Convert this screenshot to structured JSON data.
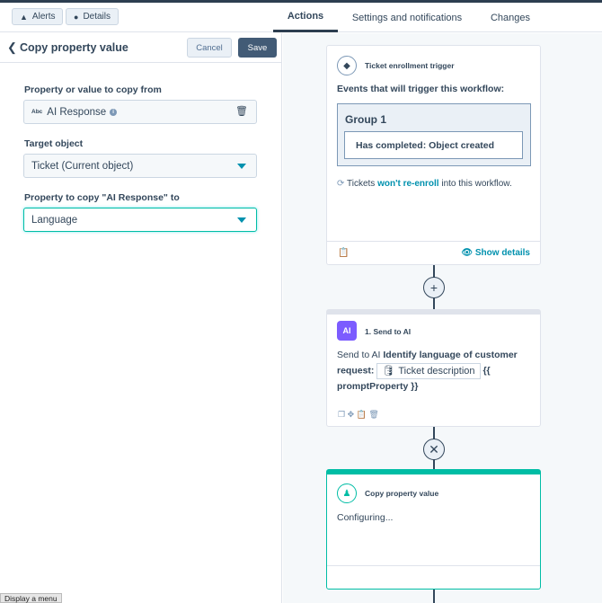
{
  "topbar": {
    "alerts_label": "Alerts",
    "details_label": "Details",
    "tabs": [
      {
        "label": "Actions"
      },
      {
        "label": "Settings and notifications"
      },
      {
        "label": "Changes"
      }
    ]
  },
  "panel": {
    "title": "Copy property value",
    "cancel_label": "Cancel",
    "save_label": "Save",
    "fields": {
      "source_label": "Property or value to copy from",
      "source_badge": "Abc",
      "source_value": "AI Response",
      "target_label": "Target object",
      "target_value": "Ticket (Current object)",
      "dest_label": "Property to copy \"AI Response\" to",
      "dest_value": "Language"
    },
    "menu_hint": "Display a menu"
  },
  "workflow": {
    "trigger": {
      "title": "Ticket enrollment trigger",
      "subtitle": "Events that will trigger this workflow:",
      "group_title": "Group 1",
      "condition": "Has completed: Object created",
      "reenroll_prefix": "Tickets",
      "reenroll_link": "won't re-enroll",
      "reenroll_suffix": "into this workflow.",
      "show_details": "Show details"
    },
    "step1": {
      "icon_text": "AI",
      "title": "1. Send to AI",
      "text_prefix": "Send to AI",
      "text_bold": "Identify language of customer request:",
      "pill": "Ticket description",
      "text_after": "{{",
      "text_bold2": "promptProperty }}"
    },
    "step2": {
      "title": "Copy property value",
      "status": "Configuring..."
    }
  }
}
